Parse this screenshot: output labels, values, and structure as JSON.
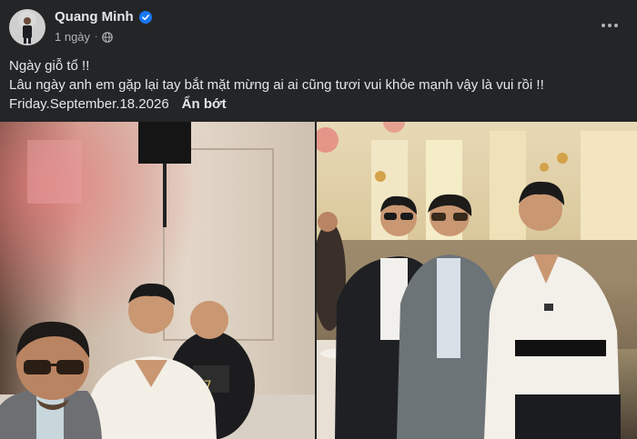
{
  "post": {
    "author_name": "Quang Minh",
    "verified_icon": "verified-badge-icon",
    "time_ago": "1 ngày",
    "privacy_icon": "globe-icon",
    "more_icon": "more-options-icon",
    "caption_line1": "Ngày giỗ tổ  !!",
    "caption_line2": "Lâu ngày anh em gặp lại tay bắt mặt mừng ai ai cũng tươi vui khỏe mạnh vậy là vui rồi  !!",
    "caption_date": "Friday.September.18.2026",
    "see_less": "Ẩn bớt",
    "colors": {
      "background": "#242526",
      "text": "#e4e6eb",
      "secondary": "#b0b3b8",
      "verified": "#1877f2"
    }
  }
}
